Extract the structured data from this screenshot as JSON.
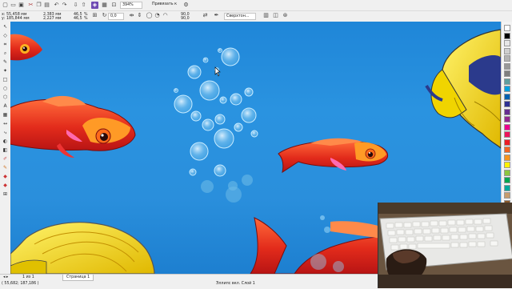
{
  "toolbar": {
    "x_label": "x:",
    "x_value": "55,458 мм",
    "y_label": "y:",
    "y_value": "185,844 мм",
    "w_value": "2,383 мм",
    "h_value": "2,227 мм",
    "scale_x": "46,5",
    "scale_y": "46,5",
    "pct": "%",
    "rotation": "0,0",
    "zoom": "394%",
    "snap_label": "Привязать к",
    "outline_w": "90,0",
    "outline_h": "90,0",
    "outline_style": "Сверхтон..."
  },
  "statusbar": {
    "coords": "( 55,682; 187,186 )",
    "page_nav": "1 из 1",
    "page_tab": "Страница 1",
    "layer_info": "Эллипс вкл. Слой 1"
  },
  "palette": {
    "colors": [
      "#ffffff",
      "#000000",
      "#e6e6e6",
      "#cfcfcf",
      "#b3b3b3",
      "#999999",
      "#7f7f7f",
      "#5f9ea0",
      "#00a0e0",
      "#0060b0",
      "#2e3192",
      "#662d91",
      "#92278f",
      "#ec008c",
      "#ed145b",
      "#ed1c24",
      "#f26522",
      "#f7941d",
      "#fff200",
      "#8dc63f",
      "#00a651",
      "#00a99d",
      "#c69c6d",
      "#8b5a2b"
    ]
  },
  "icons": {
    "pick_tool": "↖",
    "shape_tool": "◇",
    "crop_tool": "⌗",
    "zoom_tool": "⌕",
    "freehand_tool": "✎",
    "rect_tool": "□",
    "ellipse_tool": "○",
    "text_tool": "A",
    "fill_tool": "◆",
    "lock": "🔒",
    "undo": "↶",
    "redo": "↷"
  }
}
